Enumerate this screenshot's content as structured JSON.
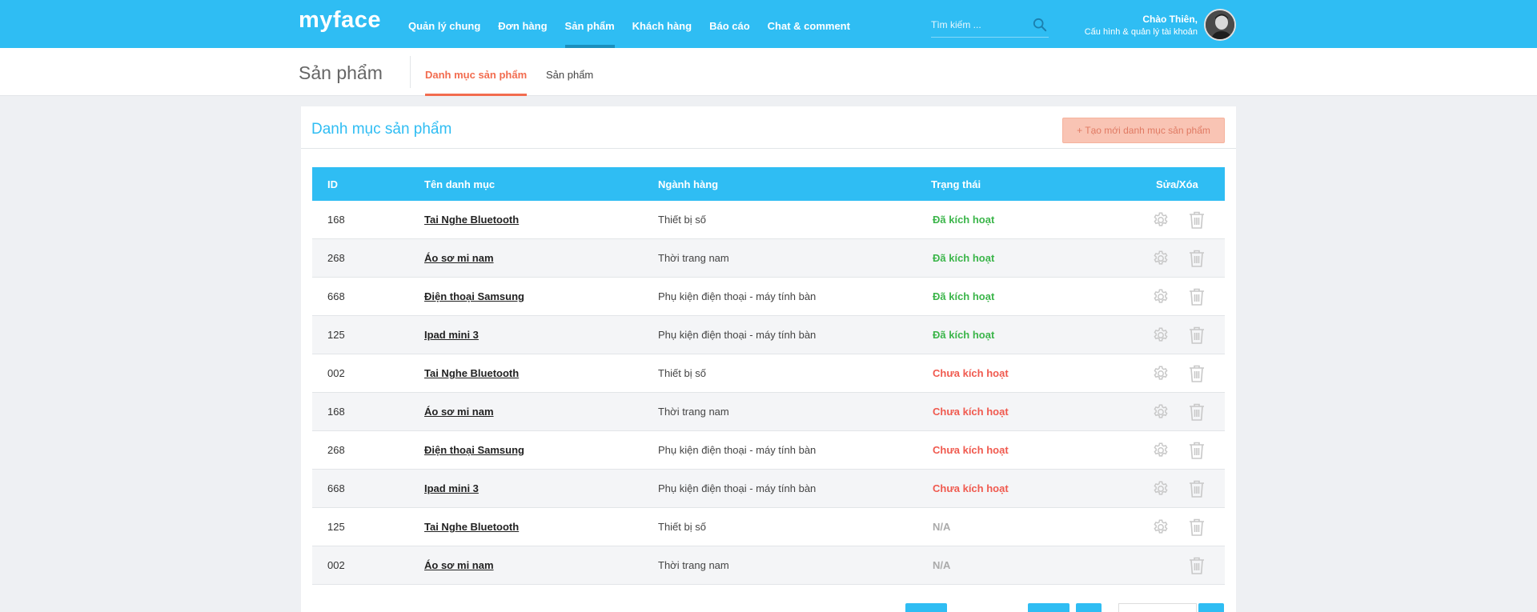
{
  "app": {
    "logo": "myface"
  },
  "nav": [
    {
      "label": "Quản lý chung",
      "active": false
    },
    {
      "label": "Đơn hàng",
      "active": false
    },
    {
      "label": "Sản phẩm",
      "active": true
    },
    {
      "label": "Khách hàng",
      "active": false
    },
    {
      "label": "Báo cáo",
      "active": false
    },
    {
      "label": "Chat & comment",
      "active": false
    }
  ],
  "search": {
    "placeholder": "Tìm kiếm ..."
  },
  "user": {
    "greeting": "Chào Thiên,",
    "account_link": "Cấu hình & quản lý tài khoản"
  },
  "subheader": {
    "title": "Sản phẩm",
    "tabs": [
      {
        "label": "Danh mục sản phẩm",
        "active": true
      },
      {
        "label": "Sản phẩm",
        "active": false
      }
    ]
  },
  "card": {
    "title": "Danh mục sản phẩm",
    "create_button": "+ Tạo mới danh mục sản phẩm"
  },
  "table": {
    "headers": {
      "id": "ID",
      "name": "Tên danh mục",
      "category": "Ngành hàng",
      "status": "Trạng thái",
      "actions": "Sửa/Xóa"
    },
    "rows": [
      {
        "id": "168",
        "name": "Tai Nghe Bluetooth",
        "category": "Thiết bị số",
        "status": "Đã kích hoạt",
        "state": "on"
      },
      {
        "id": "268",
        "name": "Áo sơ mi nam",
        "category": "Thời trang nam",
        "status": "Đã kích hoạt",
        "state": "on"
      },
      {
        "id": "668",
        "name": "Điện thoại Samsung",
        "category": "Phụ kiện điện thoại - máy tính bàn",
        "status": "Đã kích hoạt",
        "state": "on"
      },
      {
        "id": "125",
        "name": "Ipad mini 3",
        "category": "Phụ kiện điện thoại - máy tính bàn",
        "status": "Đã kích hoạt",
        "state": "on"
      },
      {
        "id": "002",
        "name": "Tai Nghe Bluetooth",
        "category": "Thiết bị số",
        "status": "Chưa kích hoạt",
        "state": "off"
      },
      {
        "id": "168",
        "name": "Áo sơ mi nam",
        "category": "Thời trang nam",
        "status": "Chưa kích hoạt",
        "state": "off"
      },
      {
        "id": "268",
        "name": "Điện thoại Samsung",
        "category": "Phụ kiện điện thoại - máy tính bàn",
        "status": "Chưa kích hoạt",
        "state": "off"
      },
      {
        "id": "668",
        "name": "Ipad mini 3",
        "category": "Phụ kiện điện thoại - máy tính bàn",
        "status": "Chưa kích hoạt",
        "state": "off"
      },
      {
        "id": "125",
        "name": "Tai Nghe Bluetooth",
        "category": "Thiết bị số",
        "status": "N/A",
        "state": "na"
      },
      {
        "id": "002",
        "name": "Áo sơ mi nam",
        "category": "Thời trang nam",
        "status": "N/A",
        "state": "na"
      }
    ]
  },
  "colors": {
    "primary": "#2fbdf3",
    "accent": "#f26c4f",
    "active": "#3bb54a",
    "inactive": "#f05a4f",
    "na": "#aaaaaa"
  }
}
